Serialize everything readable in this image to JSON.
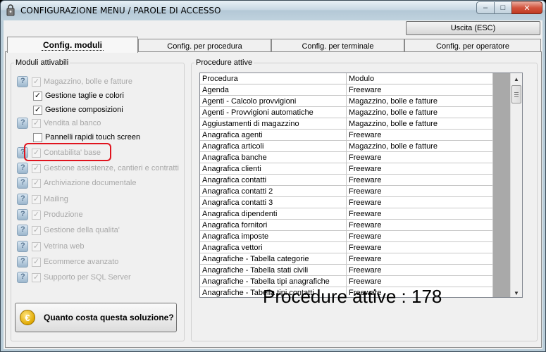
{
  "window": {
    "title": "CONFIGURAZIONE MENU / PAROLE DI ACCESSO",
    "controls": {
      "minimize": "–",
      "maximize": "□",
      "close": "✕"
    }
  },
  "toolbar": {
    "exit_label": "Uscita (ESC)"
  },
  "tabs": [
    {
      "label": "Config. moduli",
      "active": true
    },
    {
      "label": "Config. per procedura",
      "active": false
    },
    {
      "label": "Config. per terminale",
      "active": false
    },
    {
      "label": "Config. per operatore",
      "active": false
    }
  ],
  "modules": {
    "legend": "Moduli attivabili",
    "items": [
      {
        "label": "Magazzino, bolle e fatture",
        "checked": true,
        "enabled": false,
        "icon": "help-icon",
        "indent": false
      },
      {
        "label": "Gestione taglie e colori",
        "checked": true,
        "enabled": true,
        "icon": "",
        "indent": true
      },
      {
        "label": "Gestione composizioni",
        "checked": true,
        "enabled": true,
        "icon": "",
        "indent": true
      },
      {
        "label": "Vendita al banco",
        "checked": true,
        "enabled": false,
        "icon": "help-icon",
        "indent": false
      },
      {
        "label": "Pannelli rapidi touch screen",
        "checked": false,
        "enabled": true,
        "icon": "",
        "indent": true
      },
      {
        "label": "Contabilita' base",
        "checked": true,
        "enabled": false,
        "icon": "help-icon",
        "indent": false
      },
      {
        "label": "Gestione assistenze, cantieri e contratti",
        "checked": true,
        "enabled": false,
        "icon": "help-icon",
        "indent": false
      },
      {
        "label": "Archiviazione documentale",
        "checked": true,
        "enabled": false,
        "icon": "help-icon",
        "indent": false
      },
      {
        "label": "Mailing",
        "checked": true,
        "enabled": false,
        "icon": "help-icon",
        "indent": false
      },
      {
        "label": "Produzione",
        "checked": true,
        "enabled": false,
        "icon": "help-icon",
        "indent": false
      },
      {
        "label": "Gestione della qualita'",
        "checked": true,
        "enabled": false,
        "icon": "help-icon",
        "indent": false
      },
      {
        "label": "Vetrina web",
        "checked": true,
        "enabled": false,
        "icon": "help-icon",
        "indent": false
      },
      {
        "label": "Ecommerce avanzato",
        "checked": true,
        "enabled": false,
        "icon": "help-icon",
        "indent": false
      },
      {
        "label": "Supporto per SQL Server",
        "checked": true,
        "enabled": false,
        "icon": "help-icon",
        "indent": false
      }
    ],
    "highlight_color": "#e0141e",
    "quote_button": {
      "label": "Quanto costa questa soluzione?",
      "icon": "euro-coin-icon",
      "symbol": "€"
    }
  },
  "procedures": {
    "legend": "Procedure attive",
    "columns": [
      "Procedura",
      "Modulo"
    ],
    "rows": [
      [
        "Agenda",
        "Freeware"
      ],
      [
        "Agenti - Calcolo provvigioni",
        "Magazzino, bolle e fatture"
      ],
      [
        "Agenti - Provvigioni automatiche",
        "Magazzino, bolle e fatture"
      ],
      [
        "Aggiustamenti di magazzino",
        "Magazzino, bolle e fatture"
      ],
      [
        "Anagrafica agenti",
        "Freeware"
      ],
      [
        "Anagrafica articoli",
        "Magazzino, bolle e fatture"
      ],
      [
        "Anagrafica banche",
        "Freeware"
      ],
      [
        "Anagrafica clienti",
        "Freeware"
      ],
      [
        "Anagrafica contatti",
        "Freeware"
      ],
      [
        "Anagrafica contatti 2",
        "Freeware"
      ],
      [
        "Anagrafica contatti 3",
        "Freeware"
      ],
      [
        "Anagrafica dipendenti",
        "Freeware"
      ],
      [
        "Anagrafica fornitori",
        "Freeware"
      ],
      [
        "Anagrafica imposte",
        "Freeware"
      ],
      [
        "Anagrafica vettori",
        "Freeware"
      ],
      [
        "Anagrafiche - Tabella categorie",
        "Freeware"
      ],
      [
        "Anagrafiche - Tabella stati civili",
        "Freeware"
      ],
      [
        "Anagrafiche - Tabella tipi anagrafiche",
        "Freeware"
      ],
      [
        "Anagrafiche - Tabella tipi contatti",
        "Freeware"
      ]
    ],
    "scroll": {
      "up": "▲",
      "down": "▼"
    },
    "count_text": "Procedure attive : 178"
  }
}
